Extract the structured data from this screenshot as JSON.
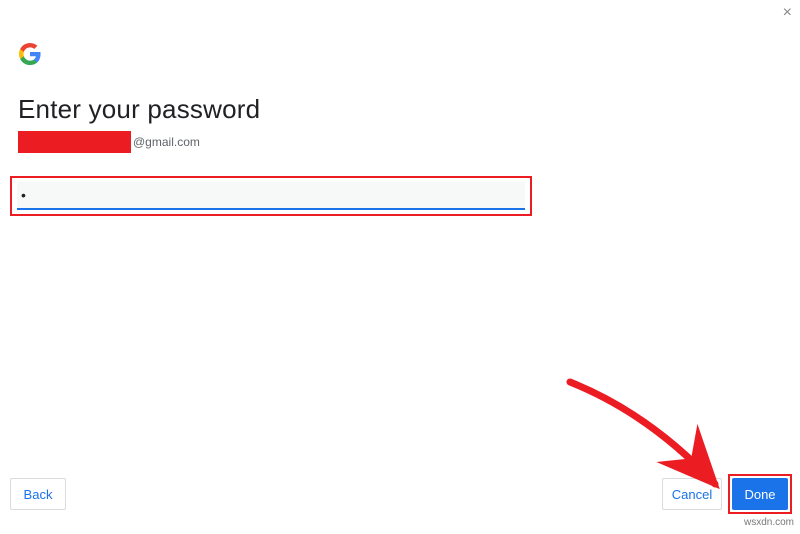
{
  "close_label": "×",
  "heading": "Enter your password",
  "email": {
    "domain_part": "@gmail.com"
  },
  "password_value": "•",
  "buttons": {
    "back": "Back",
    "cancel": "Cancel",
    "done": "Done"
  },
  "watermark": "wsxdn.com"
}
